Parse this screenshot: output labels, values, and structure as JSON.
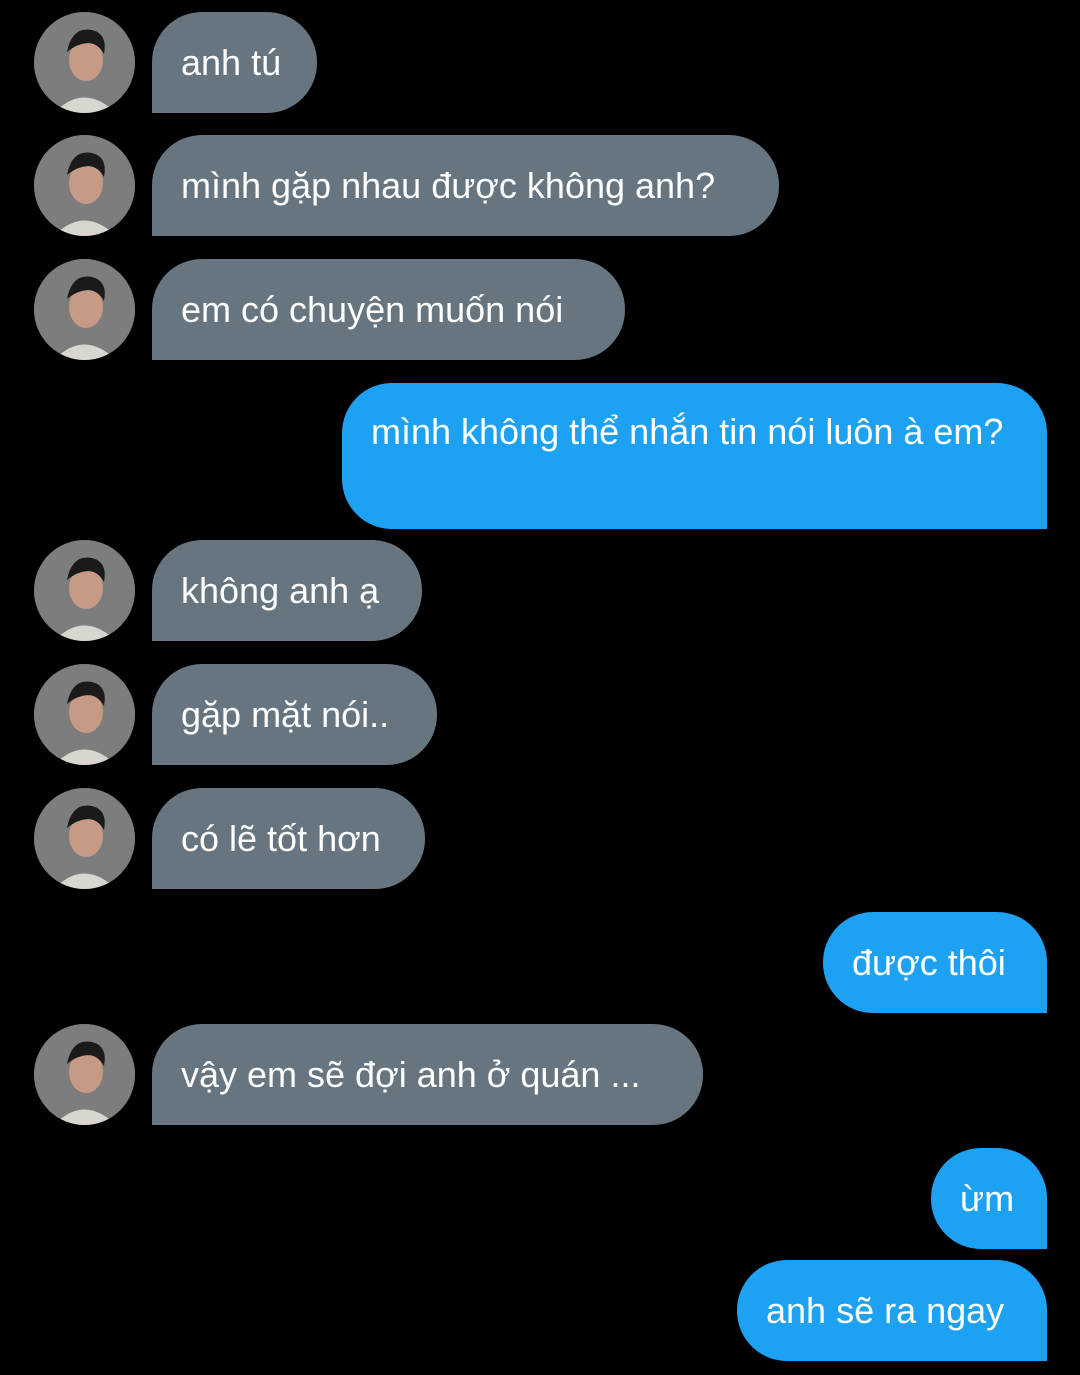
{
  "conversation": {
    "messages": [
      {
        "from": "them",
        "text": "anh tú"
      },
      {
        "from": "them",
        "text": "mình gặp nhau được không anh?"
      },
      {
        "from": "them",
        "text": "em có chuyện muốn nói"
      },
      {
        "from": "me",
        "text": "mình không thể nhắn tin nói luôn à em?"
      },
      {
        "from": "them",
        "text": "không anh ạ"
      },
      {
        "from": "them",
        "text": "gặp mặt nói.."
      },
      {
        "from": "them",
        "text": "có lẽ tốt hơn"
      },
      {
        "from": "me",
        "text": "được thôi"
      },
      {
        "from": "them",
        "text": "vậy em sẽ đợi anh ở quán ..."
      },
      {
        "from": "me",
        "text": "ừm"
      },
      {
        "from": "me",
        "text": "anh sẽ ra ngay"
      }
    ]
  },
  "theme": {
    "background": "#000000",
    "incoming_bubble": "#66757f",
    "outgoing_bubble": "#1da1f2",
    "text": "#ffffff"
  }
}
